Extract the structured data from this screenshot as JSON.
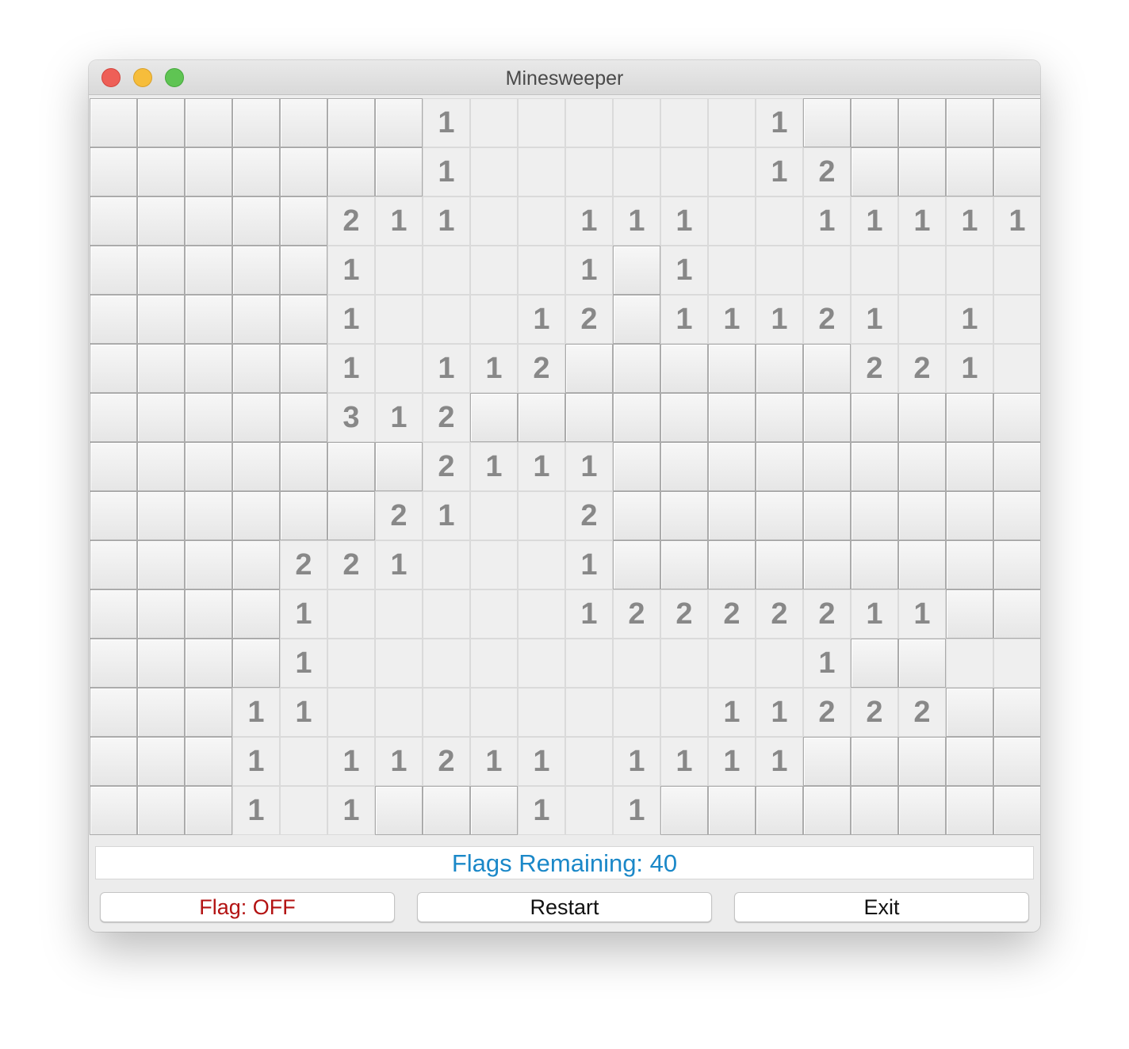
{
  "window": {
    "title": "Minesweeper"
  },
  "board": {
    "rows": 15,
    "cols": 20,
    "number_color": "#888888",
    "grid": [
      "#######1......1#####",
      "#######1......12####",
      "#####211..111..11111",
      "#####1....1#1.......",
      "#####1...12#11121.1.",
      "#####1.112######221",
      "#####312############",
      "#######2111#########",
      "######21..2#########",
      "####221...1#########",
      "####1.....12222211##",
      "####1..........1##..",
      "###11........11222##",
      "###1.11211.1111#####",
      "###1.1###1.1########"
    ]
  },
  "status": {
    "flags_remaining": "Flags Remaining: 40",
    "color": "#1b88c8"
  },
  "buttons": {
    "flag_label": "Flag: OFF",
    "flag_color": "#b31212",
    "restart_label": "Restart",
    "exit_label": "Exit"
  }
}
